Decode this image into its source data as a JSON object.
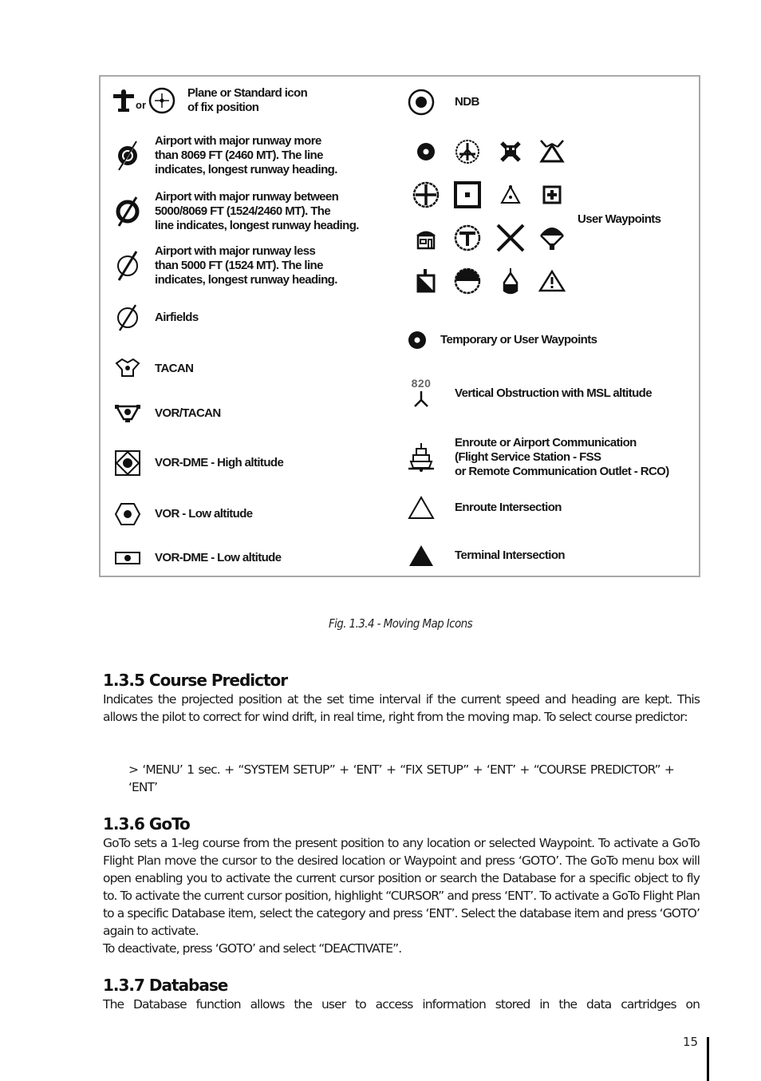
{
  "figure": {
    "left_column": [
      {
        "icon": "plane-or-standard-fix-icon",
        "label": "Plane or Standard icon\nof fix position",
        "or_text": "or"
      },
      {
        "icon": "airport-major-runway-large-icon",
        "label": "Airport with major runway more\nthan 8069 FT (2460 MT). The line\nindicates, longest runway heading."
      },
      {
        "icon": "airport-major-runway-medium-icon",
        "label": "Airport with major runway between\n5000/8069 FT (1524/2460 MT). The\nline indicates, longest runway heading."
      },
      {
        "icon": "airport-major-runway-small-icon",
        "label": "Airport with major runway less\nthan 5000 FT (1524 MT). The line\nindicates, longest runway heading."
      },
      {
        "icon": "airfield-icon",
        "label": "Airfields"
      },
      {
        "icon": "tacan-icon",
        "label": "TACAN"
      },
      {
        "icon": "vor-tacan-icon",
        "label": "VOR/TACAN"
      },
      {
        "icon": "vor-dme-high-icon",
        "label": "VOR-DME - High altitude"
      },
      {
        "icon": "vor-low-icon",
        "label": "VOR - Low altitude"
      },
      {
        "icon": "vor-dme-low-icon",
        "label": "VOR-DME - Low altitude"
      }
    ],
    "right_column": [
      {
        "icon": "ndb-icon",
        "label": "NDB"
      },
      {
        "icon": "user-waypoints-grid",
        "label": "User Waypoints"
      },
      {
        "icon": "temporary-waypoint-icon",
        "label": "Temporary or User Waypoints"
      },
      {
        "icon": "vertical-obstruction-icon",
        "label": "Vertical Obstruction with MSL altitude",
        "altitude_text": "820"
      },
      {
        "icon": "communication-station-icon",
        "label": "Enroute or Airport Communication\n(Flight Service Station - FSS\nor  Remote Communication Outlet - RCO)"
      },
      {
        "icon": "enroute-intersection-icon",
        "label": "Enroute Intersection"
      },
      {
        "icon": "terminal-intersection-icon",
        "label": "Terminal Intersection"
      }
    ],
    "user_waypoint_icons": [
      [
        "dot-waypoint-icon",
        "airport-waypoint-icon",
        "skull-crossbones-icon",
        "radio-tower-icon"
      ],
      [
        "crosshair-waypoint-icon",
        "square-dot-icon",
        "small-triangle-dot-icon",
        "first-aid-icon"
      ],
      [
        "house-icon",
        "t-circle-icon",
        "x-mark-icon",
        "parachute-icon"
      ],
      [
        "flag-icon",
        "half-circle-icon",
        "balloon-icon",
        "warning-icon"
      ]
    ],
    "caption": "Fig. 1.3.4 - Moving Map Icons"
  },
  "sections": {
    "course_predictor": {
      "heading": "1.3.5 Course Predictor",
      "body": "Indicates the projected position at the set time interval if the current speed and heading are kept. This allows the pilot to correct for wind drift, in real time, right from the moving map. To select course predictor:",
      "command": "> ‘MENU’ 1 sec. + “SYSTEM SETUP” + ‘ENT’ + “FIX SETUP” + ‘ENT’ + “COURSE PREDICTOR” + ‘ENT’"
    },
    "goto": {
      "heading": "1.3.6 GoTo",
      "body": "GoTo sets a 1-leg course from the present position to any location or selected Waypoint. To activate a GoTo Flight Plan move the cursor to the desired location or Waypoint and press ‘GOTO’. The GoTo menu box will open enabling you to activate the current cursor position or search the Database for a specific object to fly to. To activate the current cursor position, highlight “CURSOR” and press ‘ENT’. To activate a GoTo Flight Plan to a specific Database item, select the category and press ‘ENT’. Select the database item and press ‘GOTO’ again to activate.",
      "body2": "To deactivate, press ‘GOTO’ and select “DEACTIVATE”."
    },
    "database": {
      "heading": "1.3.7 Database",
      "body": "The Database function allows the user to access information stored in the data cartridges on"
    }
  },
  "footer": {
    "page_number": "15"
  }
}
